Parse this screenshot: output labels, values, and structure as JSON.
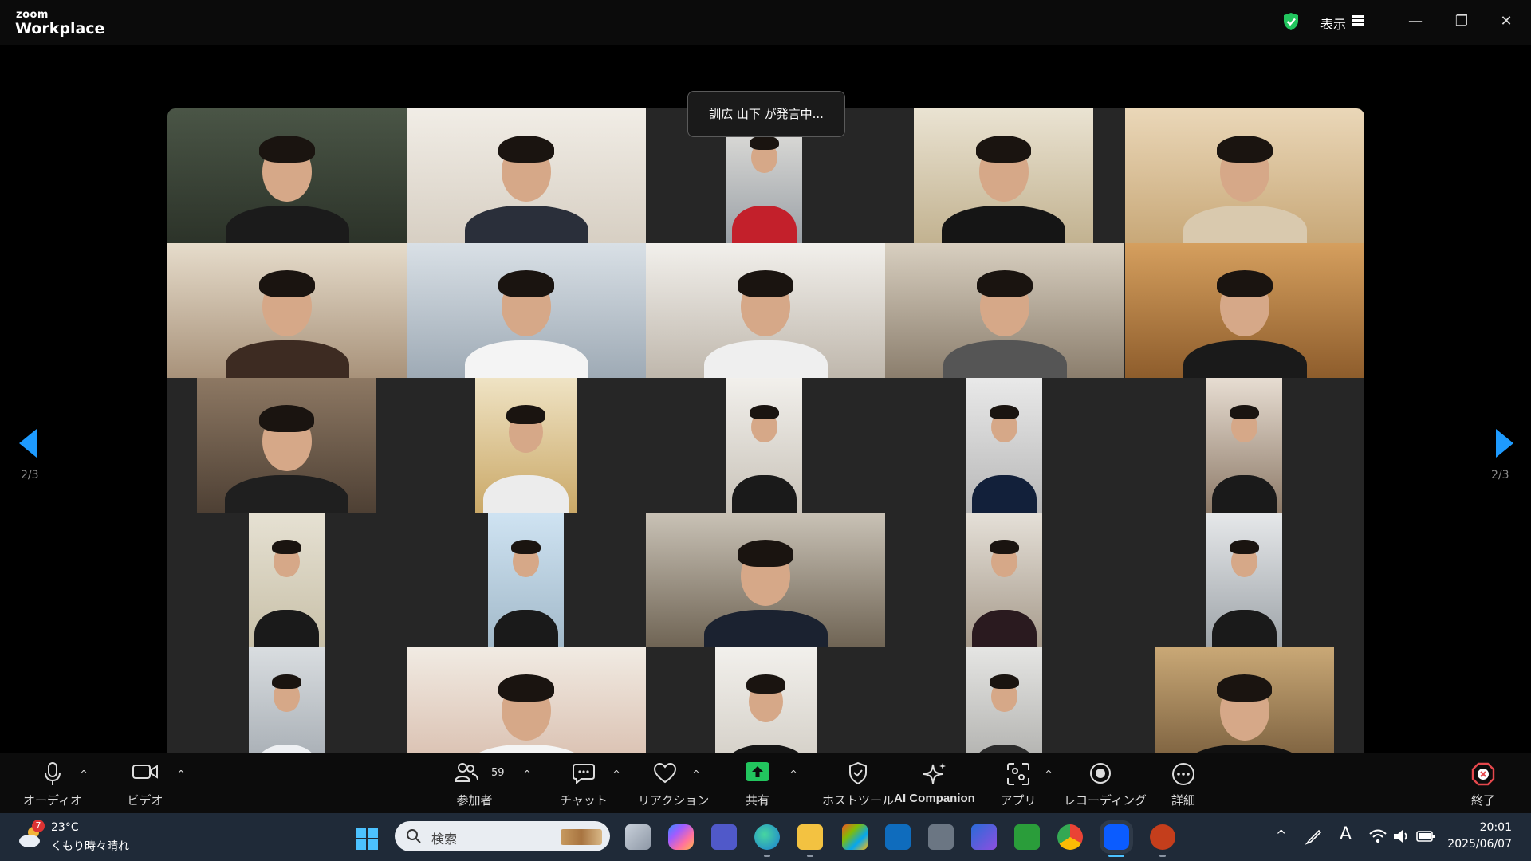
{
  "window": {
    "logo_small": "zoom",
    "logo_big": "Workplace",
    "view_label": "表示",
    "minimize": "—",
    "restore": "❐",
    "close": "✕"
  },
  "meeting": {
    "speaker_toast": "訓広 山下 が発言中...",
    "page_left": "2/3",
    "page_right": "2/3"
  },
  "toolbar": {
    "audio": "オーディオ",
    "video": "ビデオ",
    "participants": "参加者",
    "participants_count": "59",
    "chat": "チャット",
    "reactions": "リアクション",
    "share": "共有",
    "host_tools": "ホストツール",
    "ai_companion": "AI Companion",
    "apps": "アプリ",
    "recording": "レコーディング",
    "more": "詳細",
    "end": "終了",
    "caret": "^"
  },
  "taskbar": {
    "weather_badge": "7",
    "weather_temp": "23°C",
    "weather_desc": "くもり時々晴れ",
    "search_placeholder": "検索",
    "ime_mode": "A",
    "clock_time": "20:01",
    "clock_date": "2025/06/07",
    "tray_caret": "^"
  },
  "colors": {
    "accent": "#1e9bff",
    "share_green": "#22c55e",
    "end_red": "#e5484d",
    "tile_background": "#262626"
  }
}
